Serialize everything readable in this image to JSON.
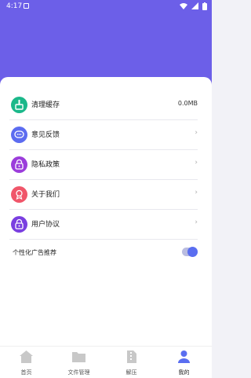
{
  "status_bar": {
    "time": "4:17"
  },
  "menu": [
    {
      "label": "清理缓存",
      "value": "0.0MB",
      "icon": "cleaner-icon",
      "color": "#1bb88a"
    },
    {
      "label": "意见反馈",
      "icon": "feedback-icon",
      "color": "#5c6cf0"
    },
    {
      "label": "隐私政策",
      "icon": "privacy-lock-icon",
      "color": "#9b3ddb"
    },
    {
      "label": "关于我们",
      "icon": "about-ribbon-icon",
      "color": "#f0566a"
    },
    {
      "label": "用户协议",
      "icon": "agreement-lock-icon",
      "color": "#7a3fe0"
    }
  ],
  "personalized_ads": {
    "label": "个性化广告推荐",
    "enabled": true
  },
  "tabs": [
    {
      "label": "首页",
      "icon": "home-icon",
      "active": false
    },
    {
      "label": "文件管理",
      "icon": "folder-icon",
      "active": false
    },
    {
      "label": "解压",
      "icon": "zip-icon",
      "active": false
    },
    {
      "label": "我的",
      "icon": "profile-icon",
      "active": true
    }
  ],
  "colors": {
    "header": "#6c5fe8",
    "accent": "#5a6ef0"
  }
}
